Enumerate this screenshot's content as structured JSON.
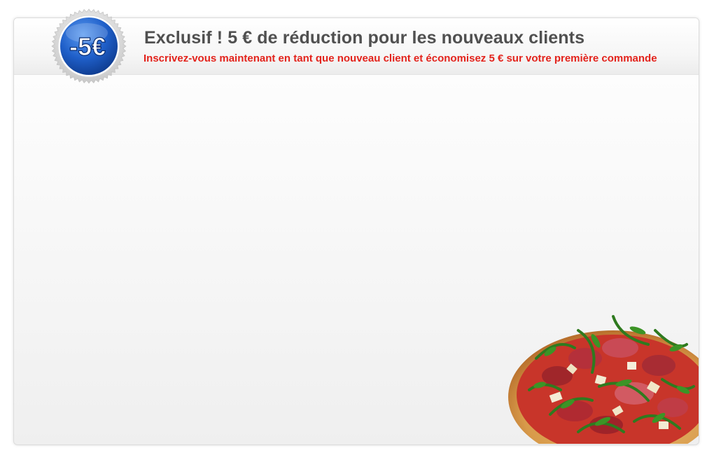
{
  "badge": {
    "text": "-5€",
    "color": "#1f5fc9"
  },
  "promo": {
    "headline": "Exclusif ! 5 € de réduction pour les nouveaux clients",
    "subline": "Inscrivez-vous maintenant en tant que nouveau client et économisez 5 € sur votre première commande"
  },
  "colors": {
    "headline": "#505050",
    "subline": "#e3231c"
  },
  "image": {
    "icon": "pizza-image"
  }
}
